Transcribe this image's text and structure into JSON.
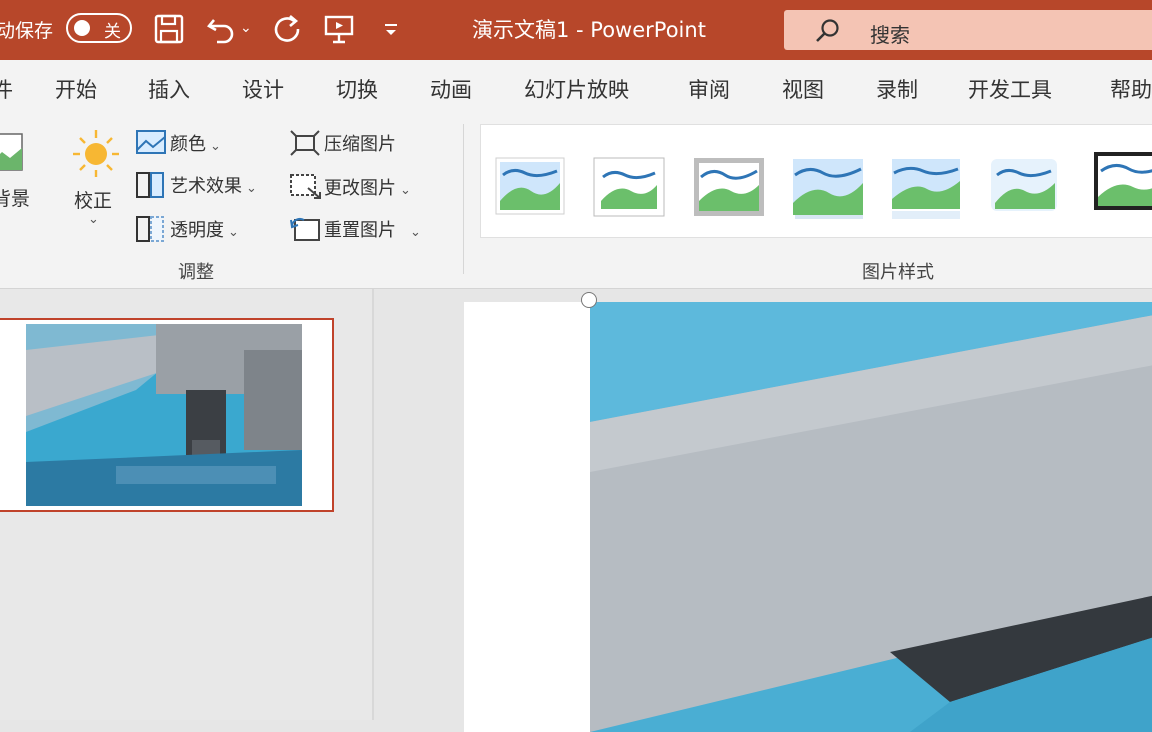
{
  "titlebar": {
    "autosave_label": "动保存",
    "autosave_toggle": "关",
    "doc_title": "演示文稿1  -  PowerPoint",
    "search_placeholder": "搜索",
    "accent": "#b7472a"
  },
  "menu": {
    "tabs": [
      "件",
      "开始",
      "插入",
      "设计",
      "切换",
      "动画",
      "幻灯片放映",
      "审阅",
      "视图",
      "录制",
      "开发工具",
      "帮助"
    ]
  },
  "ribbon": {
    "adjust": {
      "remove_bg_label": "背景",
      "corrections_label": "校正",
      "color_label": "颜色",
      "artistic_label": "艺术效果",
      "transparency_label": "透明度",
      "compress_label": "压缩图片",
      "change_label": "更改图片",
      "reset_label": "重置图片",
      "group_label": "调整"
    },
    "styles": {
      "group_label": "图片样式",
      "items": [
        "style-1",
        "style-2",
        "style-3",
        "style-4",
        "style-5",
        "style-6",
        "style-7"
      ]
    }
  },
  "slides": {
    "selected_index": 1
  },
  "icons": [
    "save-icon",
    "undo-icon",
    "redo-icon",
    "start-from-beginning-icon",
    "customize-qat-icon",
    "search-icon",
    "corrections-icon",
    "color-icon",
    "artistic-effects-icon",
    "transparency-icon",
    "compress-pictures-icon",
    "change-picture-icon",
    "reset-picture-icon",
    "rotate-handle-icon"
  ]
}
